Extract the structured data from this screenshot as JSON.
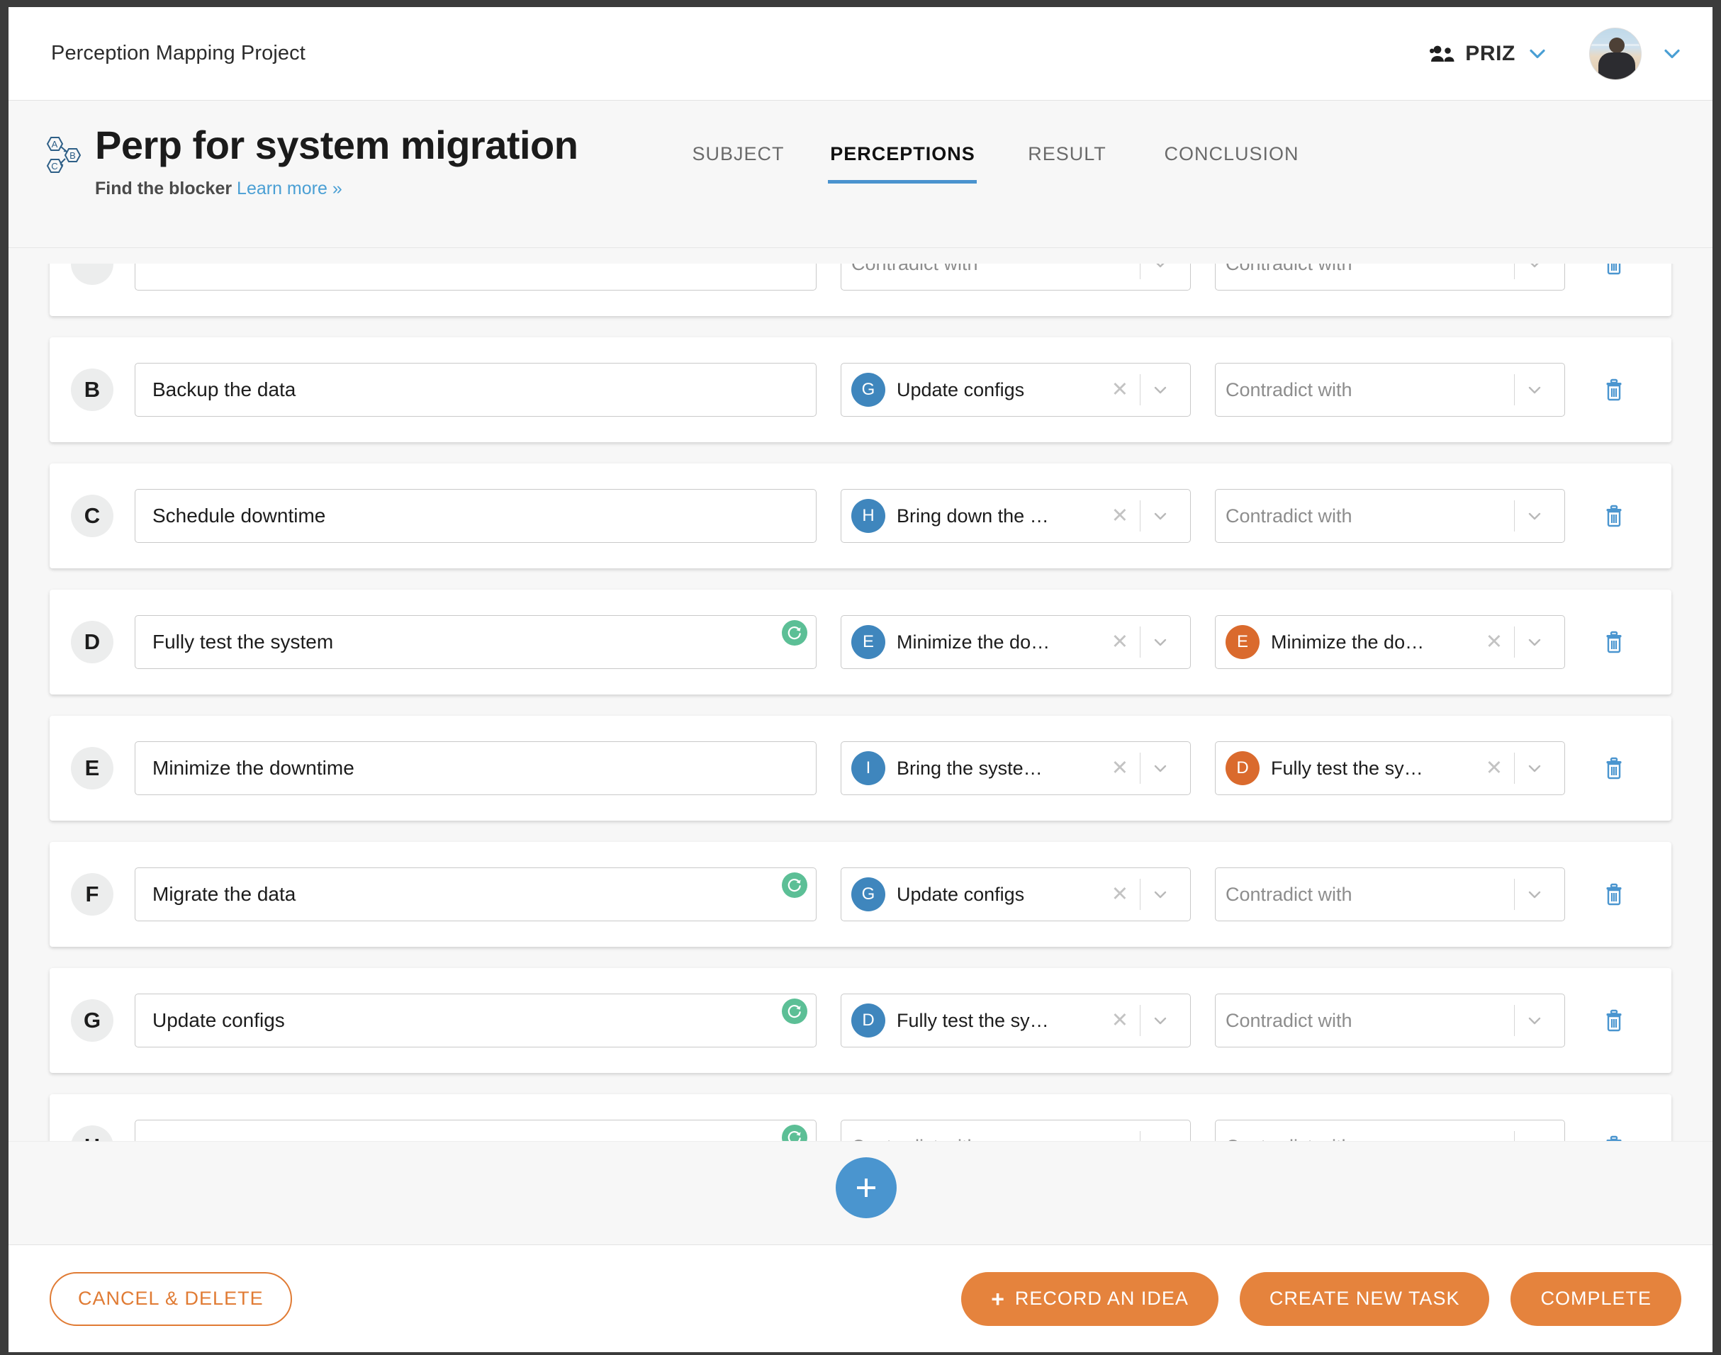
{
  "window": {
    "frame_color": "#3b3b3b"
  },
  "topbar": {
    "project_title": "Perception Mapping Project",
    "org_name": "PRIZ",
    "people_icon": "people-icon",
    "org_chevron_icon": "chevron-down-icon",
    "avatar_icon": "user-avatar",
    "account_chevron_icon": "chevron-down-icon"
  },
  "detail_header": {
    "logo_icon": "perception-map-logo",
    "title": "Perp for system migration",
    "subtitle_strong": "Find the blocker",
    "subtitle_link": "Learn more »",
    "tabs": [
      {
        "label": "SUBJECT",
        "active": false
      },
      {
        "label": "PERCEPTIONS",
        "active": true
      },
      {
        "label": "RESULT",
        "active": false
      },
      {
        "label": "CONCLUSION",
        "active": false
      }
    ]
  },
  "list": {
    "contradict_placeholder": "Contradict with",
    "clear_icon": "close-x-icon",
    "caret_icon": "chevron-down-icon",
    "delete_icon": "trash-icon",
    "loop_icon": "circular-arrow-icon",
    "rows": [
      {
        "letter": "",
        "statement": "",
        "partial": true,
        "has_loop": false,
        "cause": {
          "badge": "",
          "badge_color": "blue",
          "label": ""
        },
        "contradiction": {
          "badge": "",
          "badge_color": "",
          "label": ""
        }
      },
      {
        "letter": "B",
        "statement": "Backup the data",
        "partial": false,
        "has_loop": false,
        "cause": {
          "badge": "G",
          "badge_color": "blue",
          "label": "Update configs"
        },
        "contradiction": {
          "badge": "",
          "badge_color": "",
          "label": ""
        }
      },
      {
        "letter": "C",
        "statement": "Schedule downtime",
        "partial": false,
        "has_loop": false,
        "cause": {
          "badge": "H",
          "badge_color": "blue",
          "label": "Bring down the …"
        },
        "contradiction": {
          "badge": "",
          "badge_color": "",
          "label": ""
        }
      },
      {
        "letter": "D",
        "statement": "Fully test the system",
        "partial": false,
        "has_loop": true,
        "cause": {
          "badge": "E",
          "badge_color": "blue",
          "label": "Minimize the do…"
        },
        "contradiction": {
          "badge": "E",
          "badge_color": "orange",
          "label": "Minimize the do…"
        }
      },
      {
        "letter": "E",
        "statement": "Minimize the downtime",
        "partial": false,
        "has_loop": false,
        "cause": {
          "badge": "I",
          "badge_color": "blue",
          "label": "Bring the syste…"
        },
        "contradiction": {
          "badge": "D",
          "badge_color": "orange",
          "label": "Fully test the sy…"
        }
      },
      {
        "letter": "F",
        "statement": "Migrate the data",
        "partial": false,
        "has_loop": true,
        "cause": {
          "badge": "G",
          "badge_color": "blue",
          "label": "Update configs"
        },
        "contradiction": {
          "badge": "",
          "badge_color": "",
          "label": ""
        }
      },
      {
        "letter": "G",
        "statement": "Update configs",
        "partial": false,
        "has_loop": true,
        "cause": {
          "badge": "D",
          "badge_color": "blue",
          "label": "Fully test the sy…"
        },
        "contradiction": {
          "badge": "",
          "badge_color": "",
          "label": ""
        }
      },
      {
        "letter": "H",
        "statement": "",
        "partial": true,
        "has_loop": true,
        "cause": {
          "badge": "",
          "badge_color": "blue",
          "label": ""
        },
        "contradiction": {
          "badge": "",
          "badge_color": "",
          "label": ""
        }
      }
    ]
  },
  "add_bar": {
    "add_icon": "plus-icon",
    "add_label": "+"
  },
  "footer": {
    "cancel_label": "CANCEL & DELETE",
    "record_idea_label": "RECORD AN IDEA",
    "record_idea_plus": "+",
    "create_task_label": "CREATE NEW TASK",
    "complete_label": "COMPLETE"
  },
  "colors": {
    "accent_blue": "#4a93ce",
    "badge_blue": "#3f86bd",
    "badge_orange": "#da6a2d",
    "loop_green": "#5cbf96",
    "button_orange": "#e5833d",
    "outline_orange": "#e07b34",
    "link_blue": "#4a9fd4"
  }
}
